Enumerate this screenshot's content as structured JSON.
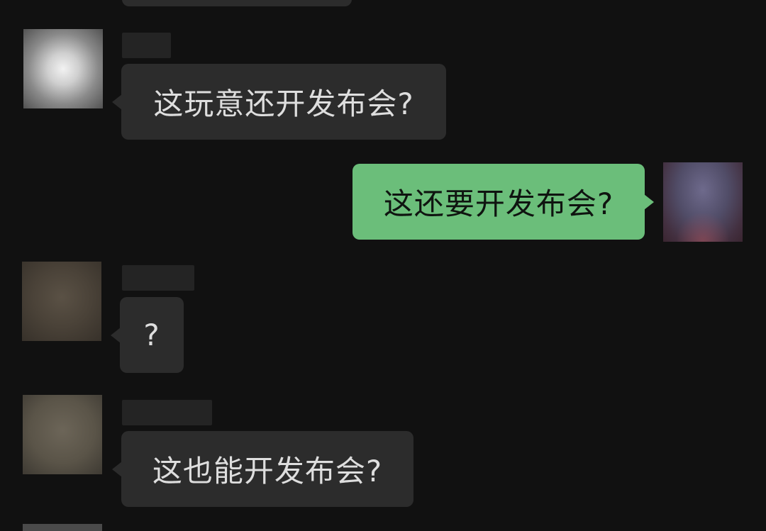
{
  "messages": [
    {
      "direction": "incoming",
      "text": "这玩意还开发布会?"
    },
    {
      "direction": "outgoing",
      "text": "这还要开发布会?"
    },
    {
      "direction": "incoming",
      "text": "?"
    },
    {
      "direction": "incoming",
      "text": "这也能开发布会?"
    }
  ],
  "colors": {
    "background": "#111111",
    "incoming_bubble": "#2c2c2c",
    "outgoing_bubble": "#6bbe7a"
  }
}
